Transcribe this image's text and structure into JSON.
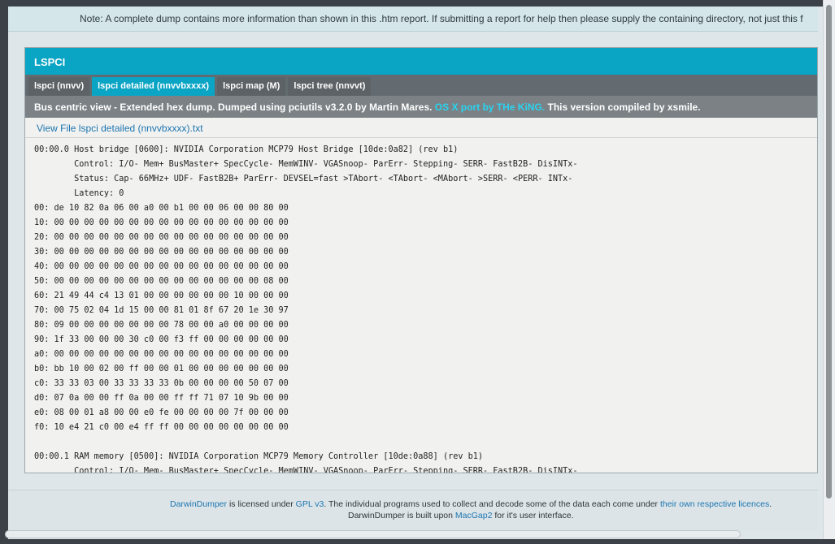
{
  "note": "Note: A complete dump contains more information than shown in this .htm report. If submitting a report for help then please supply the containing directory, not just this f",
  "panel": {
    "title": "LSPCI",
    "tabs": [
      {
        "label": "lspci (nnvv)"
      },
      {
        "label": "lspci detailed (nnvvbxxxx)"
      },
      {
        "label": "lspci map (M)"
      },
      {
        "label": "lspci tree (nnvvt)"
      }
    ],
    "description": {
      "text1": "Bus centric view - Extended hex dump. Dumped using pciutils v3.2.0 by Martin Mares. ",
      "accent": "OS X port by THe KiNG.",
      "text2": " This version compiled by xsmile."
    },
    "view_file_link": "View File lspci detailed (nnvvbxxxx).txt",
    "dump_lines": [
      "00:00.0 Host bridge [0600]: NVIDIA Corporation MCP79 Host Bridge [10de:0a82] (rev b1)",
      "        Control: I/O- Mem+ BusMaster+ SpecCycle- MemWINV- VGASnoop- ParErr- Stepping- SERR- FastB2B- DisINTx-",
      "        Status: Cap- 66MHz+ UDF- FastB2B+ ParErr- DEVSEL=fast >TAbort- <TAbort- <MAbort- >SERR- <PERR- INTx-",
      "        Latency: 0",
      "00: de 10 82 0a 06 00 a0 00 b1 00 00 06 00 00 80 00",
      "10: 00 00 00 00 00 00 00 00 00 00 00 00 00 00 00 00",
      "20: 00 00 00 00 00 00 00 00 00 00 00 00 00 00 00 00",
      "30: 00 00 00 00 00 00 00 00 00 00 00 00 00 00 00 00",
      "40: 00 00 00 00 00 00 00 00 00 00 00 00 00 00 00 00",
      "50: 00 00 00 00 00 00 00 00 00 00 00 00 00 00 08 00",
      "60: 21 49 44 c4 13 01 00 00 00 00 00 00 10 00 00 00",
      "70: 00 75 02 04 1d 15 00 00 81 01 8f 67 20 1e 30 97",
      "80: 09 00 00 00 00 00 00 00 78 00 00 a0 00 00 00 00",
      "90: 1f 33 00 00 00 30 c0 00 f3 ff 00 00 00 00 00 00",
      "a0: 00 00 00 00 00 00 00 00 00 00 00 00 00 00 00 00",
      "b0: bb 10 00 02 00 ff 00 00 01 00 00 00 00 00 00 00",
      "c0: 33 33 03 00 33 33 33 33 0b 00 00 00 00 50 07 00",
      "d0: 07 0a 00 00 ff 0a 00 00 ff ff 71 07 10 9b 00 00",
      "e0: 08 00 01 a8 00 00 e0 fe 00 00 00 00 7f 00 00 00",
      "f0: 10 e4 21 c0 00 e4 ff ff 00 00 00 00 00 00 00 00",
      "",
      "00:00.1 RAM memory [0500]: NVIDIA Corporation MCP79 Memory Controller [10de:0a88] (rev b1)",
      "        Control: I/O- Mem- BusMaster+ SpecCycle- MemWINV- VGASnoop- ParErr- Stepping- SERR- FastB2B- DisINTx-"
    ]
  },
  "footer": {
    "line1_link1": "DarwinDumper",
    "line1_text1": " is licensed under ",
    "line1_link2": "GPL v3",
    "line1_text2": ". The individual programs used to collect and decode some of the data each come under ",
    "line1_link3": "their own respective licences",
    "line1_text3": ".",
    "line2_text1": "DarwinDumper is built upon ",
    "line2_link": "MacGap2",
    "line2_text2": " for it's user interface."
  }
}
